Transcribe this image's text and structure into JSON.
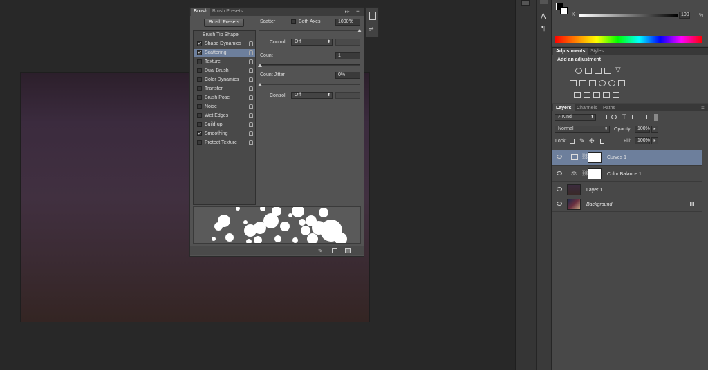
{
  "brush_panel": {
    "tabs": [
      "Brush",
      "Brush Presets"
    ],
    "presets_button": "Brush Presets",
    "options": [
      {
        "label": "Brush Tip Shape",
        "checked": null
      },
      {
        "label": "Shape Dynamics",
        "checked": true
      },
      {
        "label": "Scattering",
        "checked": true,
        "selected": true
      },
      {
        "label": "Texture",
        "checked": false
      },
      {
        "label": "Dual Brush",
        "checked": false
      },
      {
        "label": "Color Dynamics",
        "checked": false
      },
      {
        "label": "Transfer",
        "checked": false
      },
      {
        "label": "Brush Pose",
        "checked": false
      },
      {
        "label": "Noise",
        "checked": false
      },
      {
        "label": "Wet Edges",
        "checked": false
      },
      {
        "label": "Build-up",
        "checked": false
      },
      {
        "label": "Smoothing",
        "checked": true
      },
      {
        "label": "Protect Texture",
        "checked": false
      }
    ],
    "scatter_label": "Scatter",
    "both_axes_label": "Both Axes",
    "scatter_value": "1000%",
    "control_label": "Control:",
    "control_value": "Off",
    "count_label": "Count",
    "count_value": "1",
    "count_jitter_label": "Count Jitter",
    "count_jitter_value": "0%",
    "control2_label": "Control:",
    "control2_value": "Off"
  },
  "color_panel": {
    "k_label": "K",
    "k_value": "100",
    "percent": "%"
  },
  "adjustments": {
    "tabs": [
      "Adjustments",
      "Styles"
    ],
    "title": "Add an adjustment"
  },
  "layers": {
    "tabs": [
      "Layers",
      "Channels",
      "Paths"
    ],
    "filter_kind": "Kind",
    "blend_mode": "Normal",
    "opacity_label": "Opacity:",
    "opacity_value": "100%",
    "lock_label": "Lock:",
    "fill_label": "Fill:",
    "fill_value": "100%",
    "rows": [
      {
        "name": "Curves 1",
        "selected": true
      },
      {
        "name": "Color Balance 1",
        "selected": false
      },
      {
        "name": "Layer 1",
        "selected": false
      },
      {
        "name": "Background",
        "selected": false,
        "italic": true
      }
    ]
  }
}
